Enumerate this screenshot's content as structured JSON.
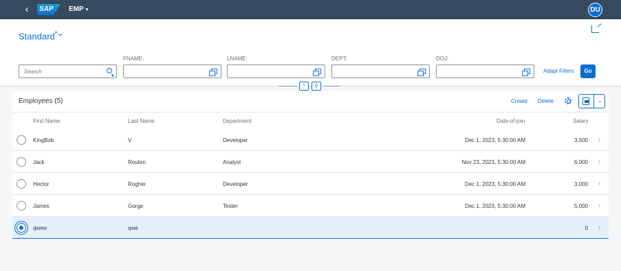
{
  "shell": {
    "back_icon": "back-arrow-icon",
    "logo_text": "SAP",
    "app_title": "EMP",
    "app_title_caret": "▾",
    "avatar_initials": "DU",
    "colors": {
      "shell_bg": "#354a5f",
      "accent": "#0a6ed1"
    }
  },
  "header": {
    "variant_name": "Standard",
    "variant_dirty_marker": "*",
    "search_placeholder": "Search",
    "filters": [
      {
        "label": "FNAME:",
        "value": ""
      },
      {
        "label": "LNAME:",
        "value": ""
      },
      {
        "label": "DEPT:",
        "value": ""
      },
      {
        "label": "DOJ:",
        "value": ""
      }
    ],
    "adapt_filters_label": "Adapt Filters",
    "go_label": "Go"
  },
  "table": {
    "title": "Employees (5)",
    "create_label": "Create",
    "delete_label": "Delete",
    "columns": [
      "First Name",
      "Last Name",
      "Department",
      "Date-of-join",
      "Salary"
    ],
    "rows": [
      {
        "first": "KingBob",
        "last": "V",
        "dept": "Developer",
        "doj": "Dec 1, 2023, 5:30:00 AM",
        "salary": "3,500",
        "selected": false
      },
      {
        "first": "Jack",
        "last": "Routen",
        "dept": "Analyst",
        "doj": "Nov 23, 2023, 5:30:00 AM",
        "salary": "6,000",
        "selected": false
      },
      {
        "first": "Hector",
        "last": "Rogher",
        "dept": "Developer",
        "doj": "Dec 1, 2023, 5:30:00 AM",
        "salary": "3,000",
        "selected": false
      },
      {
        "first": "James",
        "last": "Gorge",
        "dept": "Tester",
        "doj": "Dec 1, 2023, 5:30:00 AM",
        "salary": "5,000",
        "selected": false
      },
      {
        "first": "qwew",
        "last": "qwe",
        "dept": "",
        "doj": "",
        "salary": "0",
        "selected": true
      }
    ]
  }
}
